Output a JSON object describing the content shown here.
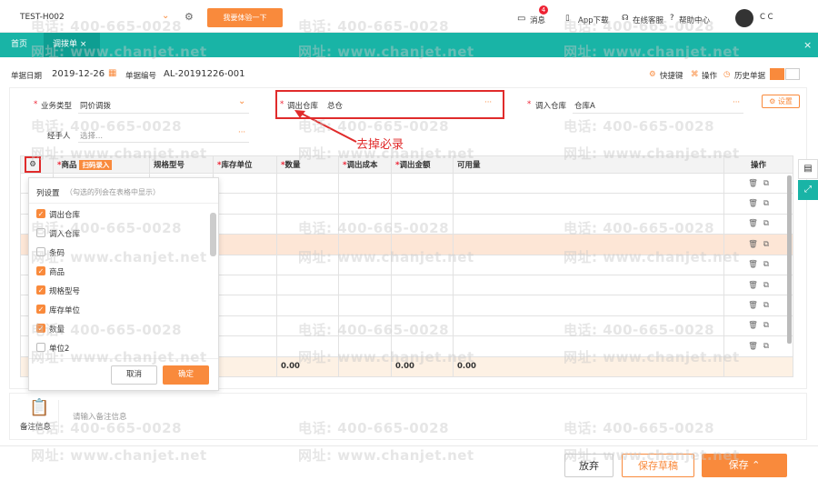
{
  "top": {
    "company": "TEST-H002",
    "try_btn": "我要体验一下",
    "badge": "4",
    "msg": "消息",
    "app": "App下载",
    "service": "在线客服",
    "help": "帮助中心",
    "user": "C C"
  },
  "tabs": {
    "home": "首页",
    "active": "调拨单"
  },
  "meta": {
    "date_label": "单据日期",
    "date": "2019-12-26",
    "no_label": "单据编号",
    "no": "AL-20191226-001",
    "shortcut": "快捷键",
    "ops": "操作",
    "history": "历史单据"
  },
  "form": {
    "biz_label": "业务类型",
    "biz_value": "同价调拨",
    "out_label": "调出仓库",
    "out_value": "总仓",
    "in_label": "调入仓库",
    "in_value": "仓库A",
    "settings": "设置",
    "handler_label": "经手人",
    "handler_placeholder": "选择..."
  },
  "annotation": "去掉必录",
  "table": {
    "cols": [
      "商品",
      "规格型号",
      "库存单位",
      "数量",
      "调出成本",
      "调出金额",
      "可用量",
      "操作"
    ],
    "scan": "扫码录入",
    "totals": {
      "qty": "0.00",
      "amount": "0.00",
      "avail": "0.00"
    }
  },
  "popup": {
    "title": "列设置",
    "hint": "（勾选的列会在表格中显示）",
    "items": [
      {
        "label": "调出仓库",
        "checked": true
      },
      {
        "label": "调入仓库",
        "checked": false
      },
      {
        "label": "条码",
        "checked": false
      },
      {
        "label": "商品",
        "checked": true
      },
      {
        "label": "规格型号",
        "checked": true
      },
      {
        "label": "库存单位",
        "checked": true
      },
      {
        "label": "数量",
        "checked": true
      },
      {
        "label": "单位2",
        "checked": false
      }
    ],
    "cancel": "取消",
    "ok": "确定"
  },
  "note": {
    "label": "备注信息",
    "placeholder": "请输入备注信息"
  },
  "footer": {
    "discard": "放弃",
    "draft": "保存草稿",
    "save": "保存"
  },
  "watermark": {
    "phone": "电话: 400-665-0028",
    "site": "网址: www.chanjet.net"
  },
  "colors": {
    "brand": "#19b4a6",
    "accent": "#f98a3c",
    "alert": "#e02b2b"
  }
}
